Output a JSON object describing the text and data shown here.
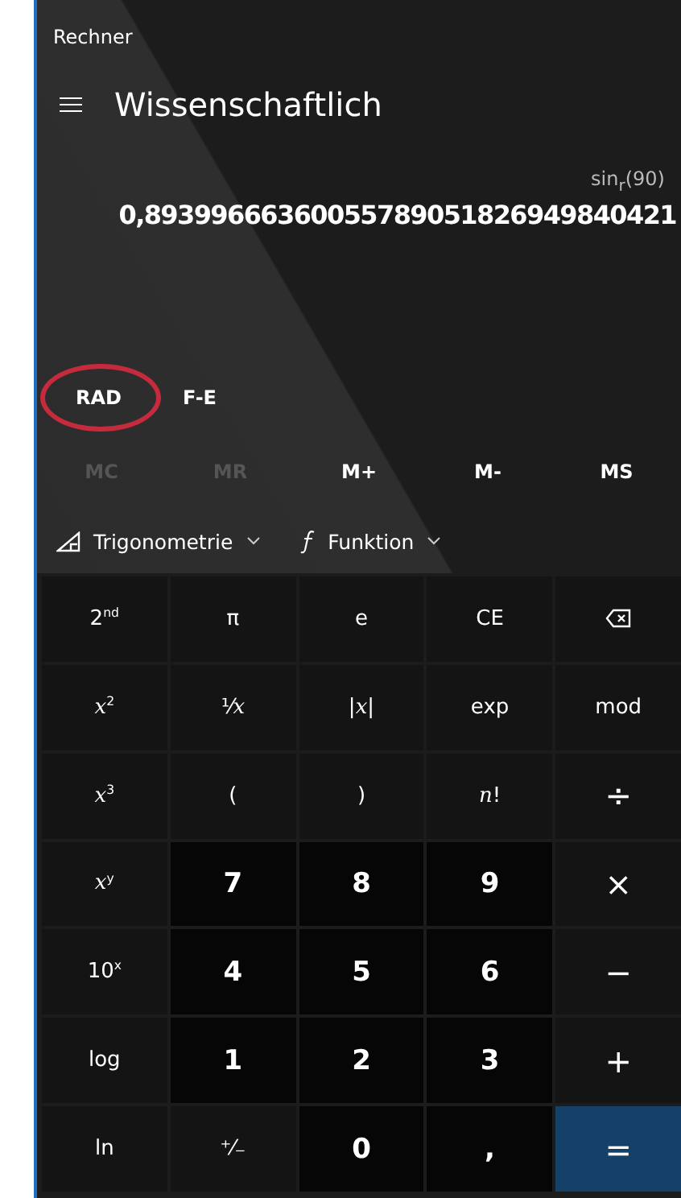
{
  "window": {
    "title": "Rechner"
  },
  "header": {
    "title": "Wissenschaftlich"
  },
  "display": {
    "expression": "sin$_{r}$(90)",
    "result": "0,89399666360055789051826949840421"
  },
  "modes": [
    {
      "label": "RAD",
      "highlighted": true
    },
    {
      "label": "F-E",
      "highlighted": false
    }
  ],
  "memory": [
    {
      "label": "MC",
      "disabled": true
    },
    {
      "label": "MR",
      "disabled": true
    },
    {
      "label": "M+",
      "disabled": false
    },
    {
      "label": "M-",
      "disabled": false
    },
    {
      "label": "MS",
      "disabled": false
    }
  ],
  "toolbar": [
    {
      "kind": "trig",
      "label": "Trigonometrie"
    },
    {
      "kind": "func",
      "label": "Funktion"
    }
  ],
  "keys": [
    {
      "kind": "fn",
      "label": "2$^{nd}$"
    },
    {
      "kind": "fn",
      "label": "π"
    },
    {
      "kind": "fn",
      "label": "e"
    },
    {
      "kind": "fn",
      "label": "CE"
    },
    {
      "kind": "backspace"
    },
    {
      "kind": "fn",
      "label": "*x*$^{2}$"
    },
    {
      "kind": "fn",
      "label": "¹⁄*x*"
    },
    {
      "kind": "fn",
      "label": "|*x*|"
    },
    {
      "kind": "fn",
      "label": "exp"
    },
    {
      "kind": "fn",
      "label": "mod"
    },
    {
      "kind": "fn",
      "label": "*x*$^{3}$"
    },
    {
      "kind": "fn",
      "label": "("
    },
    {
      "kind": "fn",
      "label": ")"
    },
    {
      "kind": "fn",
      "label": "*n*!"
    },
    {
      "kind": "op",
      "label": "÷"
    },
    {
      "kind": "fn",
      "label": "*x*$^{y}$"
    },
    {
      "kind": "num",
      "label": "7"
    },
    {
      "kind": "num",
      "label": "8"
    },
    {
      "kind": "num",
      "label": "9"
    },
    {
      "kind": "op",
      "label": "×"
    },
    {
      "kind": "fn",
      "label": "10$^{x}$"
    },
    {
      "kind": "num",
      "label": "4"
    },
    {
      "kind": "num",
      "label": "5"
    },
    {
      "kind": "num",
      "label": "6"
    },
    {
      "kind": "op",
      "label": "−"
    },
    {
      "kind": "fn",
      "label": "log"
    },
    {
      "kind": "num",
      "label": "1"
    },
    {
      "kind": "num",
      "label": "2"
    },
    {
      "kind": "num",
      "label": "3"
    },
    {
      "kind": "op",
      "label": "+"
    },
    {
      "kind": "fn",
      "label": "ln"
    },
    {
      "kind": "fn",
      "label": "⁺⁄₋"
    },
    {
      "kind": "num",
      "label": "0"
    },
    {
      "kind": "num",
      "label": ","
    },
    {
      "kind": "equals",
      "label": "="
    }
  ]
}
